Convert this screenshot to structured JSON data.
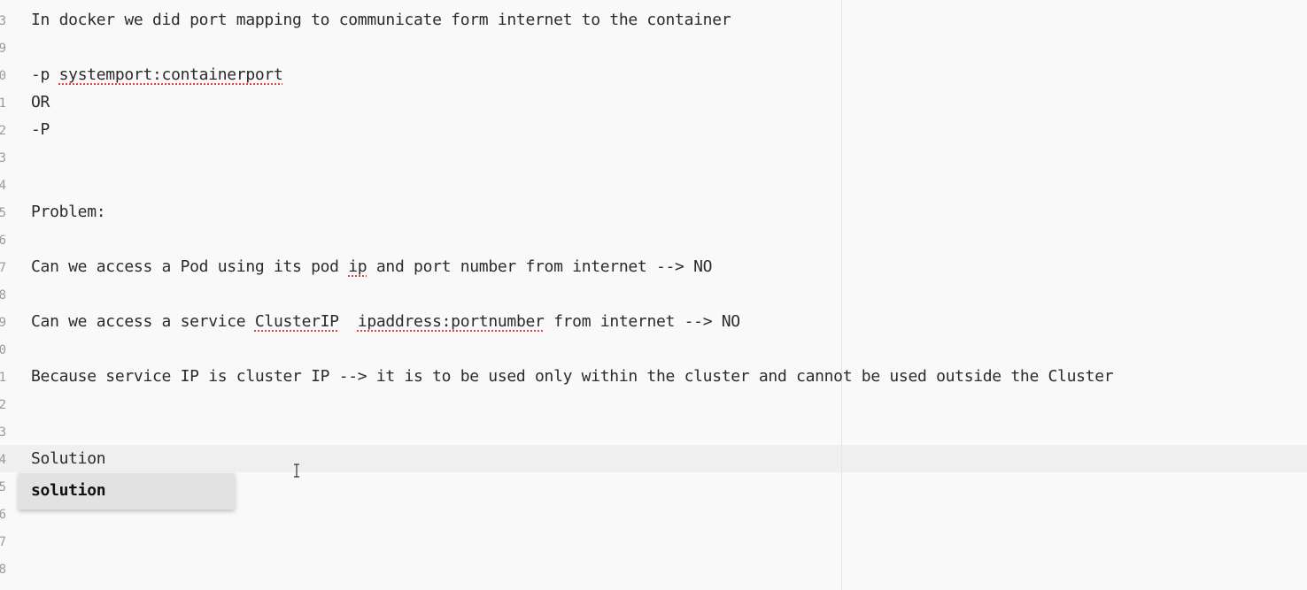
{
  "editor": {
    "gutter_numbers": [
      "3",
      "9",
      "0",
      "1",
      "2",
      "3",
      "4",
      "5",
      "6",
      "7",
      "8",
      "9",
      "0",
      "1",
      "2",
      "3",
      "4",
      "5",
      "6",
      "7",
      "8"
    ],
    "lines": {
      "l1": "In docker we did port mapping to communicate form internet to the container",
      "l2a": "-p ",
      "l2b": "systemport:containerport",
      "l3": "OR",
      "l4": "-P",
      "l5": "Problem:",
      "l6a": "Can we access a Pod using its pod ",
      "l6b": "ip",
      "l6c": " and port number from internet --> NO",
      "l7a": "Can we access a service ",
      "l7b": "ClusterIP",
      "l7c": "  ",
      "l7d": "ipaddress:portnumber",
      "l7e": " from internet --> NO",
      "l8": "Because service IP is cluster IP --> it is to be used only within the cluster and cannot be used outside the Cluster",
      "l9": "Solution"
    },
    "autocomplete": {
      "items": [
        "solution"
      ]
    },
    "cursor_icon": "text-cursor-icon"
  }
}
